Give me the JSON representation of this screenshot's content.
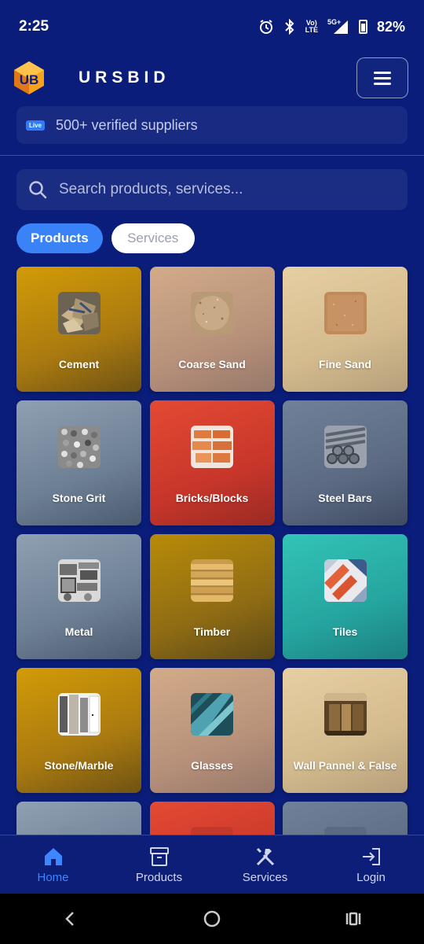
{
  "status_bar": {
    "time": "2:25",
    "volte_label": "Vo\nLTE",
    "network_label": "5G+",
    "battery": "82%"
  },
  "header": {
    "brand": "URSBID",
    "logo_text": "UB",
    "menu_icon": "hamburger-icon"
  },
  "banner": {
    "badge": "Live",
    "text": "500+ verified suppliers"
  },
  "search": {
    "placeholder": "Search products, services..."
  },
  "tabs": [
    {
      "label": "Products",
      "active": true
    },
    {
      "label": "Services",
      "active": false
    }
  ],
  "categories": [
    {
      "label": "Cement",
      "color": "#d39b07"
    },
    {
      "label": "Coarse Sand",
      "color": "#d2ab89"
    },
    {
      "label": "Fine Sand",
      "color": "#e6cfa2"
    },
    {
      "label": "Stone Grit",
      "color": "#8fa0b2"
    },
    {
      "label": "Bricks/Blocks",
      "color": "#e34a33"
    },
    {
      "label": "Steel Bars",
      "color": "#6f8198"
    },
    {
      "label": "Metal",
      "color": "#8fa0b2"
    },
    {
      "label": "Timber",
      "color": "#b88b08"
    },
    {
      "label": "Tiles",
      "color": "#33c3b7"
    },
    {
      "label": "Stone/Marble",
      "color": "#d39b07"
    },
    {
      "label": "Glasses",
      "color": "#d2ab89"
    },
    {
      "label": "Wall Pannel & False",
      "color": "#e6cfa2"
    },
    {
      "label": "",
      "color": "#8fa0b2"
    },
    {
      "label": "",
      "color": "#e34a33"
    },
    {
      "label": "",
      "color": "#6f8198"
    }
  ],
  "bottom_nav": [
    {
      "label": "Home",
      "icon": "home-icon",
      "active": true
    },
    {
      "label": "Products",
      "icon": "box-icon",
      "active": false
    },
    {
      "label": "Services",
      "icon": "tools-icon",
      "active": false
    },
    {
      "label": "Login",
      "icon": "login-icon",
      "active": false
    }
  ],
  "colors": {
    "background": "#0a1d7a",
    "accent": "#3a82f7"
  }
}
